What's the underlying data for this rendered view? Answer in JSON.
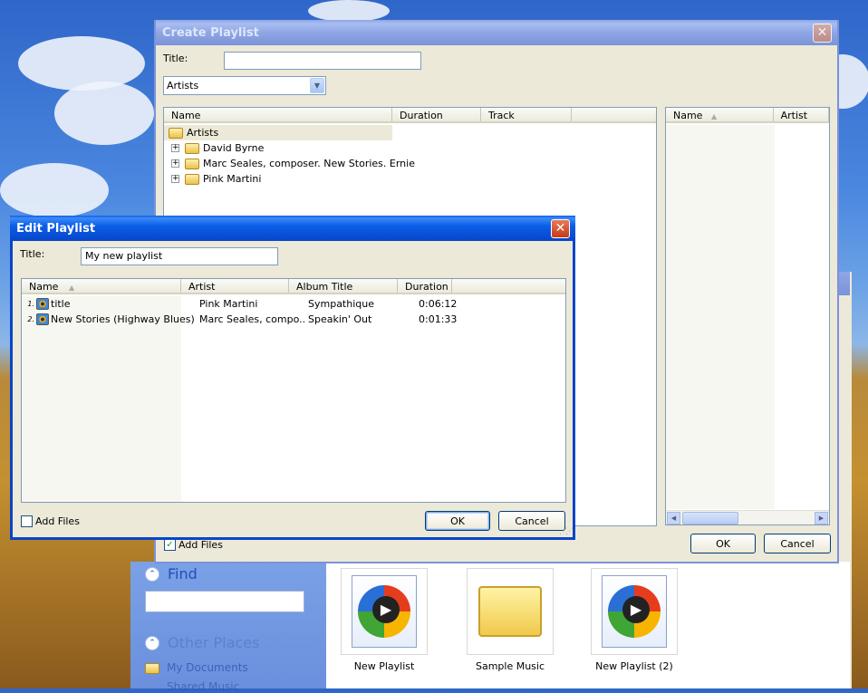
{
  "create_playlist": {
    "title": "Create Playlist",
    "title_label": "Title:",
    "title_value": "",
    "view_selected": "Artists",
    "columns": [
      "Name",
      "Duration",
      "Track"
    ],
    "tree": [
      {
        "label": "Artists",
        "level": 0
      },
      {
        "label": "David Byrne",
        "level": 1
      },
      {
        "label": "Marc Seales, composer. New Stories. Ernie",
        "level": 1
      },
      {
        "label": "Pink Martini",
        "level": 1
      }
    ],
    "right_columns": [
      "Name",
      "Artist"
    ],
    "add_files_label": "Add Files",
    "add_files_checked": true,
    "ok_label": "OK",
    "cancel_label": "Cancel"
  },
  "edit_playlist": {
    "title": "Edit Playlist",
    "title_label": "Title:",
    "title_value": "My new playlist",
    "columns": [
      "Name",
      "Artist",
      "Album Title",
      "Duration"
    ],
    "rows": [
      {
        "num": "1.",
        "name": "title",
        "artist": "Pink Martini",
        "album": "Sympathique",
        "duration": "0:06:12"
      },
      {
        "num": "2.",
        "name": "New Stories (Highway Blues)",
        "artist": "Marc Seales, compo...",
        "album": "Speakin' Out",
        "duration": "0:01:33"
      }
    ],
    "add_files_label": "Add Files",
    "add_files_checked": false,
    "ok_label": "OK",
    "cancel_label": "Cancel"
  },
  "explorer": {
    "find_title": "Find",
    "other_places_title": "Other Places",
    "places": [
      "My Documents",
      "Shared Music"
    ],
    "files": [
      {
        "name": "New Playlist",
        "icon": "media-file-icon"
      },
      {
        "name": "Sample Music",
        "icon": "folder-icon"
      },
      {
        "name": "New Playlist (2)",
        "icon": "media-file-icon"
      }
    ]
  }
}
